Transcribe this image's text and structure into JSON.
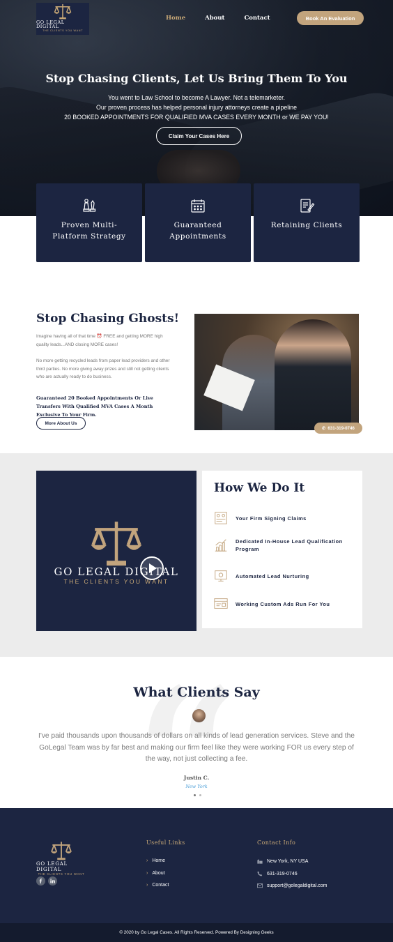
{
  "brand": {
    "name": "GO LEGAL DIGITAL",
    "tagline": "THE CLIENTS YOU WANT"
  },
  "nav": {
    "items": [
      "Home",
      "About",
      "Contact"
    ],
    "active": "Home",
    "cta": "Book An Evaluation"
  },
  "hero": {
    "title": "Stop Chasing Clients, Let Us Bring Them To You",
    "line1": "You went to Law School to become A Lawyer. Not a telemarketer.",
    "line2": "Our proven process has helped personal injury attorneys create a pipeline",
    "line3": "20 BOOKED APPOINTMENTS FOR QUALIFIED MVA CASES EVERY MONTH or WE PAY YOU!",
    "button": "Claim Your Cases Here"
  },
  "features": [
    {
      "label": "Proven Multi-Platform Strategy",
      "icon": "strategy-icon"
    },
    {
      "label": "Guaranteed Appointments",
      "icon": "calendar-icon"
    },
    {
      "label": "Retaining Clients",
      "icon": "contract-icon"
    }
  ],
  "ghosts": {
    "title": "Stop Chasing Ghosts!",
    "p1": "Imagine having all of that time ⏰ FREE and getting MORE high quality leads...AND closing MORE cases!",
    "p2": "No more getting recycled leads from paper lead providers and other third parties. No more giving away prizes and still not getting clients who are actually ready to do business.",
    "p3": "Guaranteed 20 Booked Appointments Or Live Transfers With Qualified MVA Cases A Month Exclusive To Your Firm.",
    "button": "More About Us",
    "phone": "631-319-0746"
  },
  "how": {
    "title": "How We Do It",
    "steps": [
      {
        "text": "Your Firm Signing Claims",
        "icon": "signing-icon"
      },
      {
        "text": "Dedicated In-House Lead Qualification Program",
        "icon": "growth-chart-icon"
      },
      {
        "text": "Automated Lead Nurturing",
        "icon": "automation-icon"
      },
      {
        "text": "Working Custom Ads Run For You",
        "icon": "ads-icon"
      }
    ]
  },
  "testimonials": {
    "title": "What Clients Say",
    "quote": "I've paid thousands upon thousands of dollars on all kinds of lead generation services. Steve and the GoLegal Team was by far best and making our firm feel like they were working FOR us every step of the way, not just collecting a fee.",
    "name": "Justin C.",
    "location": "New York"
  },
  "footer": {
    "useful_links_title": "Useful Links",
    "links": [
      "Home",
      "About",
      "Contact"
    ],
    "contact_title": "Contact Info",
    "address": "New York, NY USA",
    "phone": "631-319-0746",
    "email": "support@golegaldigital.com",
    "copyright": "© 2020 by Go Legal Cases. All Rights Reserved. Powered By Designing Geeks"
  },
  "colors": {
    "navy": "#1c2541",
    "gold": "#c2a47d",
    "light_gray": "#ececec"
  }
}
